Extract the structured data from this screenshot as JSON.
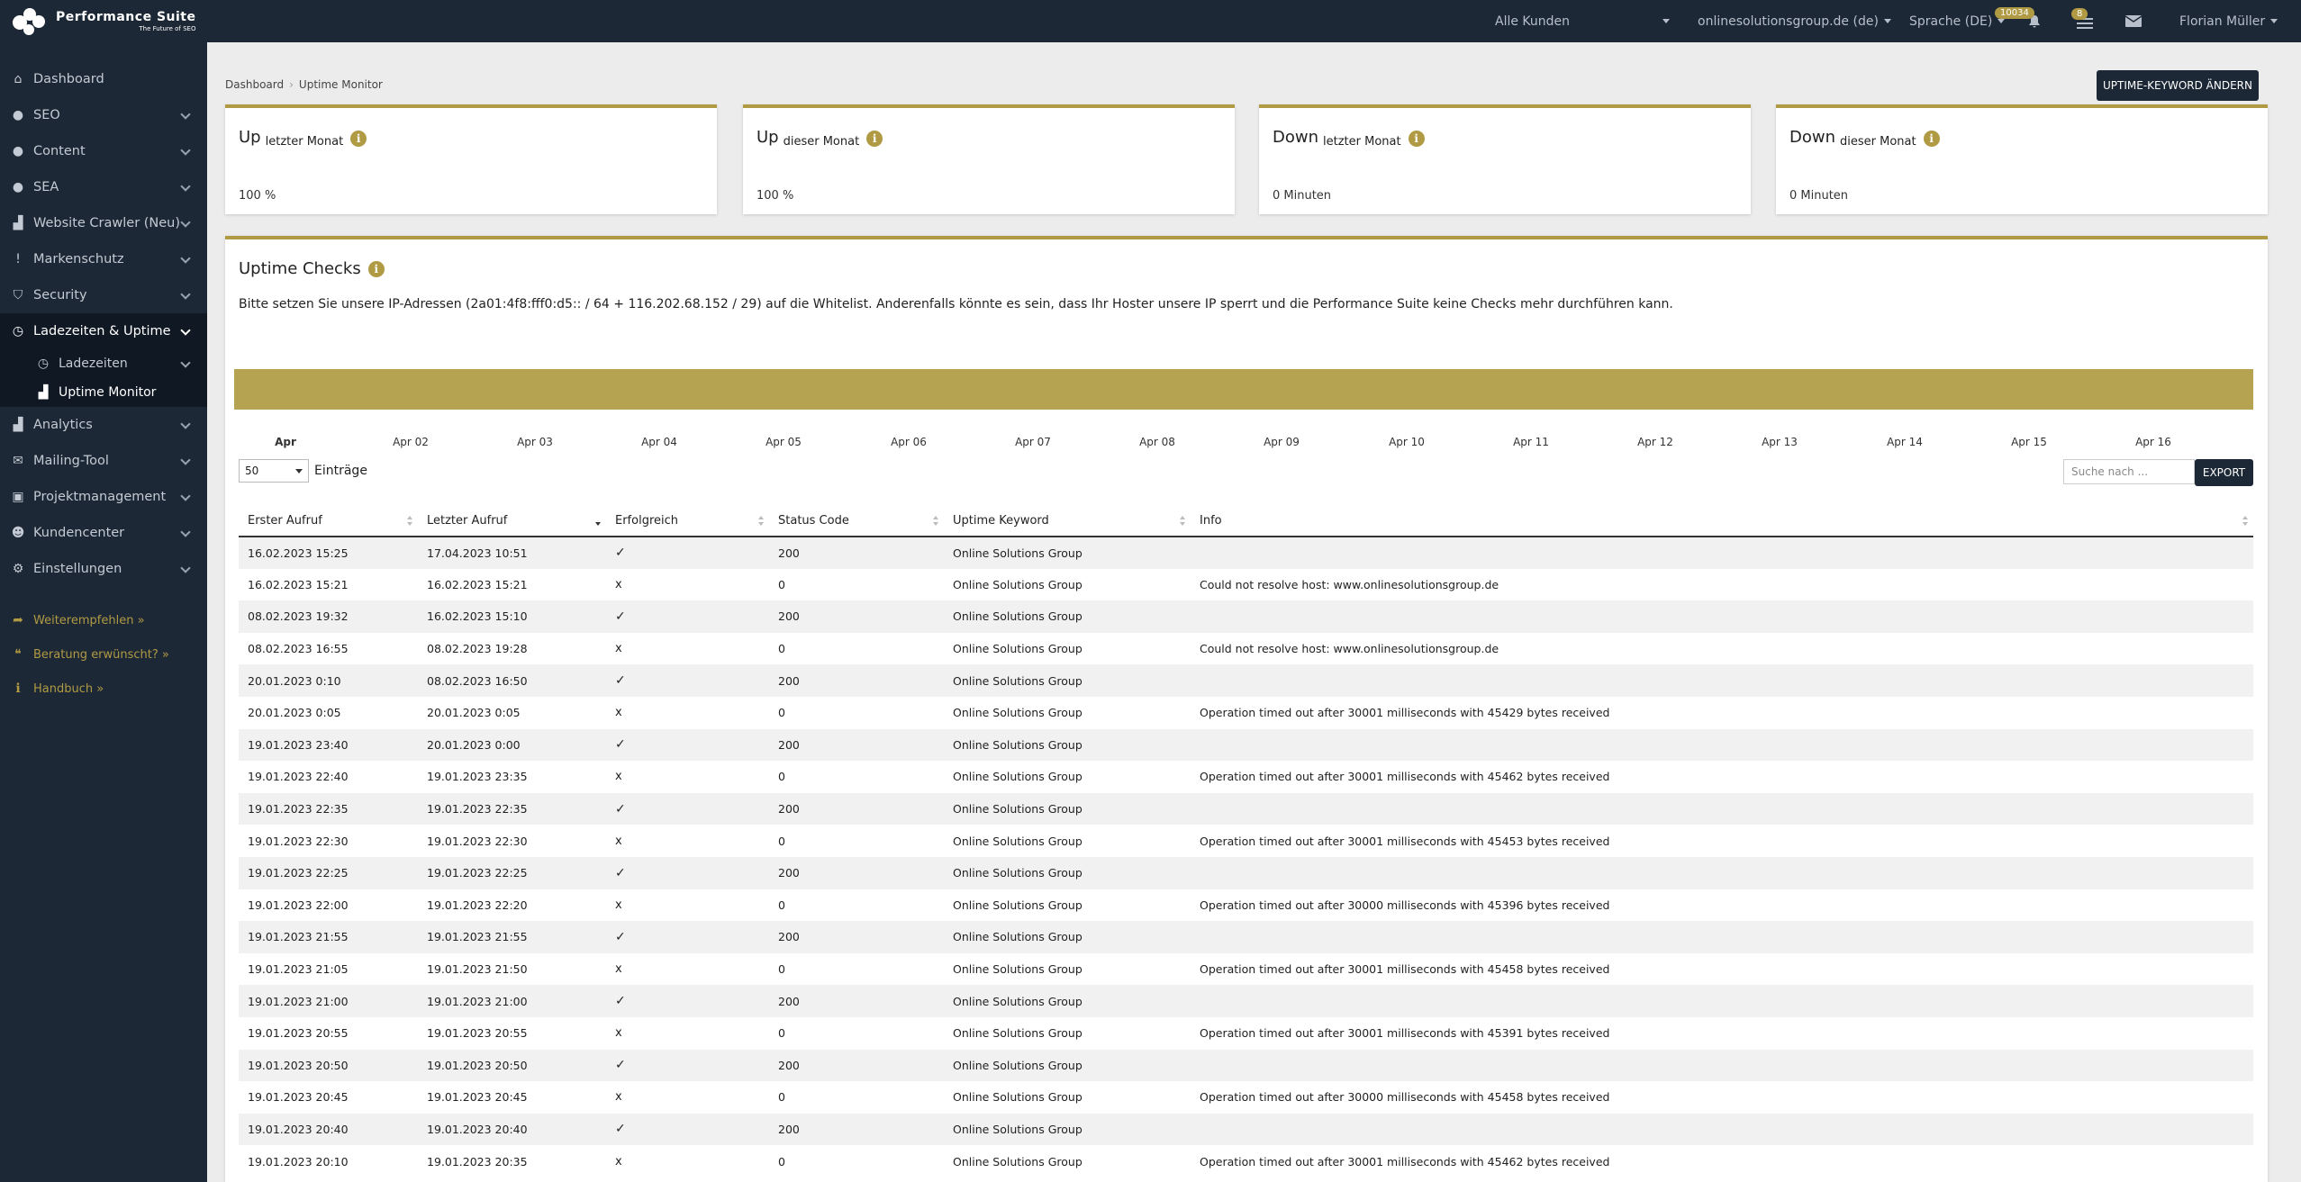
{
  "brand": {
    "name": "Performance Suite",
    "sub": "The Future of SEO"
  },
  "topbar": {
    "customer": "Alle Kunden",
    "domain": "onlinesolutionsgroup.de (de)",
    "language": "Sprache (DE)",
    "notification_count": "10034",
    "tasks_count": "8",
    "user": "Florian Müller"
  },
  "sidebar": {
    "items": [
      {
        "label": "Dashboard",
        "icon": "home-icon"
      },
      {
        "label": "SEO",
        "icon": "globe-icon"
      },
      {
        "label": "Content",
        "icon": "content-icon"
      },
      {
        "label": "SEA",
        "icon": "search-icon"
      },
      {
        "label": "Website Crawler (Neu)",
        "icon": "chart-icon"
      },
      {
        "label": "Markenschutz",
        "icon": "exclamation-icon"
      },
      {
        "label": "Security",
        "icon": "shield-icon"
      },
      {
        "label": "Ladezeiten & Uptime",
        "icon": "clock-icon"
      },
      {
        "label": "Ladezeiten",
        "icon": "clock-icon"
      },
      {
        "label": "Uptime Monitor",
        "icon": "chart-icon"
      },
      {
        "label": "Analytics",
        "icon": "chart-icon"
      },
      {
        "label": "Mailing-Tool",
        "icon": "mail-icon"
      },
      {
        "label": "Projektmanagement",
        "icon": "briefcase-icon"
      },
      {
        "label": "Kundencenter",
        "icon": "users-icon"
      },
      {
        "label": "Einstellungen",
        "icon": "gear-icon"
      }
    ],
    "extras": [
      {
        "label": "Weiterempfehlen »",
        "icon": "share-icon"
      },
      {
        "label": "Beratung erwünscht? »",
        "icon": "chat-icon"
      },
      {
        "label": "Handbuch »",
        "icon": "info-icon"
      }
    ]
  },
  "breadcrumb": {
    "home": "Dashboard",
    "current": "Uptime Monitor"
  },
  "actions": {
    "keyword_button": "UPTIME-KEYWORD ÄNDERN",
    "export_button": "EXPORT"
  },
  "stats": [
    {
      "title": "Up",
      "sub": "letzter Monat",
      "value": "100 %"
    },
    {
      "title": "Up",
      "sub": "dieser Monat",
      "value": "100 %"
    },
    {
      "title": "Down",
      "sub": "letzter Monat",
      "value": "0 Minuten"
    },
    {
      "title": "Down",
      "sub": "dieser Monat",
      "value": "0 Minuten"
    }
  ],
  "checks": {
    "title": "Uptime Checks",
    "note": "Bitte setzen Sie unsere IP-Adressen (2a01:4f8:fff0:d5:: / 64 + 116.202.68.152 / 29) auf die Whitelist. Anderenfalls könnte es sein, dass Ihr Hoster unsere IP sperrt und die Performance Suite keine Checks mehr durchführen kann.",
    "timeline": [
      "Apr",
      "Apr 02",
      "Apr 03",
      "Apr 04",
      "Apr 05",
      "Apr 06",
      "Apr 07",
      "Apr 08",
      "Apr 09",
      "Apr 10",
      "Apr 11",
      "Apr 12",
      "Apr 13",
      "Apr 14",
      "Apr 15",
      "Apr 16"
    ],
    "entries_value": "50",
    "entries_label": "Einträge",
    "search_placeholder": "Suche nach ...",
    "columns": [
      "Erster Aufruf",
      "Letzter Aufruf",
      "Erfolgreich",
      "Status Code",
      "Uptime Keyword",
      "Info"
    ],
    "rows": [
      [
        "16.02.2023 15:25",
        "17.04.2023 10:51",
        "✓",
        "200",
        "Online Solutions Group",
        ""
      ],
      [
        "16.02.2023 15:21",
        "16.02.2023 15:21",
        "x",
        "0",
        "Online Solutions Group",
        "Could not resolve host: www.onlinesolutionsgroup.de"
      ],
      [
        "08.02.2023 19:32",
        "16.02.2023 15:10",
        "✓",
        "200",
        "Online Solutions Group",
        ""
      ],
      [
        "08.02.2023 16:55",
        "08.02.2023 19:28",
        "x",
        "0",
        "Online Solutions Group",
        "Could not resolve host: www.onlinesolutionsgroup.de"
      ],
      [
        "20.01.2023 0:10",
        "08.02.2023 16:50",
        "✓",
        "200",
        "Online Solutions Group",
        ""
      ],
      [
        "20.01.2023 0:05",
        "20.01.2023 0:05",
        "x",
        "0",
        "Online Solutions Group",
        "Operation timed out after 30001 milliseconds with 45429 bytes received"
      ],
      [
        "19.01.2023 23:40",
        "20.01.2023 0:00",
        "✓",
        "200",
        "Online Solutions Group",
        ""
      ],
      [
        "19.01.2023 22:40",
        "19.01.2023 23:35",
        "x",
        "0",
        "Online Solutions Group",
        "Operation timed out after 30001 milliseconds with 45462 bytes received"
      ],
      [
        "19.01.2023 22:35",
        "19.01.2023 22:35",
        "✓",
        "200",
        "Online Solutions Group",
        ""
      ],
      [
        "19.01.2023 22:30",
        "19.01.2023 22:30",
        "x",
        "0",
        "Online Solutions Group",
        "Operation timed out after 30001 milliseconds with 45453 bytes received"
      ],
      [
        "19.01.2023 22:25",
        "19.01.2023 22:25",
        "✓",
        "200",
        "Online Solutions Group",
        ""
      ],
      [
        "19.01.2023 22:00",
        "19.01.2023 22:20",
        "x",
        "0",
        "Online Solutions Group",
        "Operation timed out after 30000 milliseconds with 45396 bytes received"
      ],
      [
        "19.01.2023 21:55",
        "19.01.2023 21:55",
        "✓",
        "200",
        "Online Solutions Group",
        ""
      ],
      [
        "19.01.2023 21:05",
        "19.01.2023 21:50",
        "x",
        "0",
        "Online Solutions Group",
        "Operation timed out after 30001 milliseconds with 45458 bytes received"
      ],
      [
        "19.01.2023 21:00",
        "19.01.2023 21:00",
        "✓",
        "200",
        "Online Solutions Group",
        ""
      ],
      [
        "19.01.2023 20:55",
        "19.01.2023 20:55",
        "x",
        "0",
        "Online Solutions Group",
        "Operation timed out after 30001 milliseconds with 45391 bytes received"
      ],
      [
        "19.01.2023 20:50",
        "19.01.2023 20:50",
        "✓",
        "200",
        "Online Solutions Group",
        ""
      ],
      [
        "19.01.2023 20:45",
        "19.01.2023 20:45",
        "x",
        "0",
        "Online Solutions Group",
        "Operation timed out after 30000 milliseconds with 45458 bytes received"
      ],
      [
        "19.01.2023 20:40",
        "19.01.2023 20:40",
        "✓",
        "200",
        "Online Solutions Group",
        ""
      ],
      [
        "19.01.2023 20:10",
        "19.01.2023 20:35",
        "x",
        "0",
        "Online Solutions Group",
        "Operation timed out after 30001 milliseconds with 45462 bytes received"
      ]
    ]
  },
  "colors": {
    "accent": "#b09a43",
    "navy": "#1d2836",
    "timeline": "#b5a351"
  }
}
